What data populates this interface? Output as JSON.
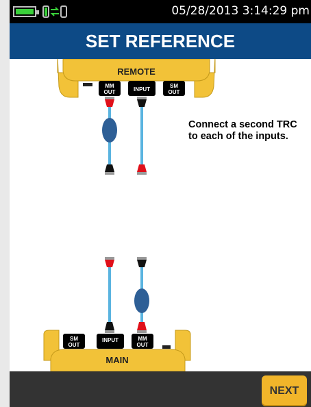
{
  "status": {
    "datetime": "05/28/2013 3:14:29 pm",
    "battery_icon": "battery-full-icon",
    "connection_icon": "connection-status-icon"
  },
  "header": {
    "title": "SET REFERENCE"
  },
  "remote_unit": {
    "label": "REMOTE",
    "ports": [
      "MM OUT",
      "INPUT",
      "SM OUT"
    ],
    "port_mm_line1": "MM",
    "port_mm_line2": "OUT",
    "port_input": "INPUT",
    "port_sm_line1": "SM",
    "port_sm_line2": "OUT"
  },
  "main_unit": {
    "label": "MAIN",
    "port_sm_line1": "SM",
    "port_sm_line2": "OUT",
    "port_input": "INPUT",
    "port_mm_line1": "MM",
    "port_mm_line2": "OUT"
  },
  "instruction": "Connect a second TRC to each of the inputs.",
  "footer": {
    "next_label": "NEXT"
  },
  "colors": {
    "title_bar": "#0d4a86",
    "device_yellow": "#f2c238",
    "cable_blue": "#5ab4e0",
    "connector_red": "#e0101a",
    "connector_black": "#111111",
    "next_button": "#f1b52a"
  }
}
